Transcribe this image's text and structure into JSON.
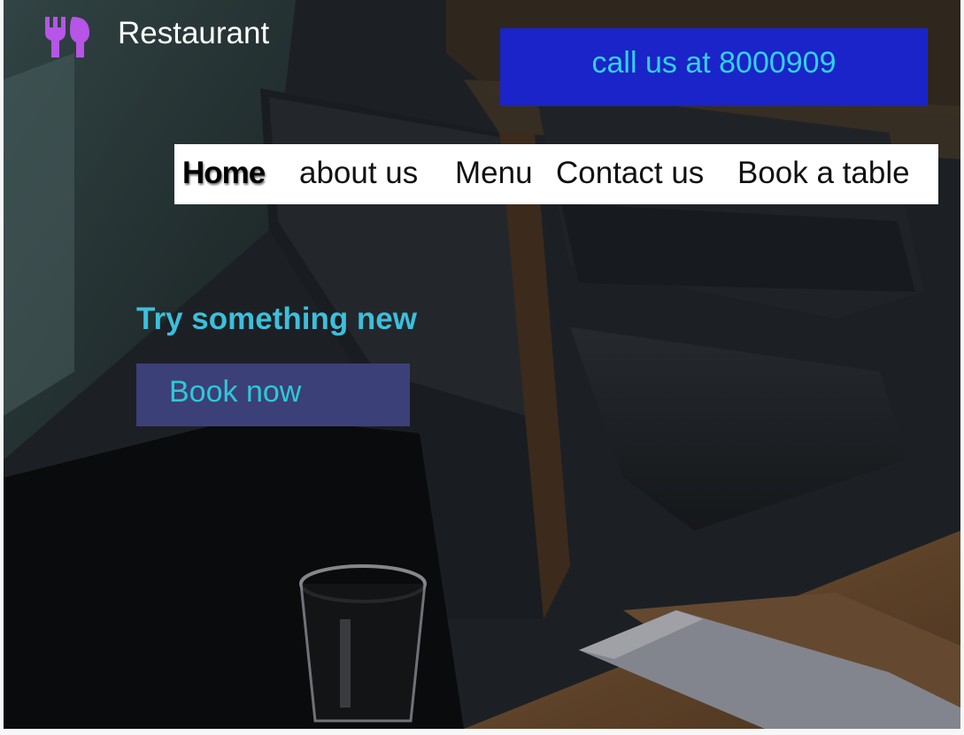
{
  "header": {
    "brand_name": "Restaurant",
    "logo_icon": "fork-spoon-icon",
    "logo_color": "#b655e6",
    "call_label": "call us at 8000909"
  },
  "nav": {
    "items": [
      {
        "label": "Home",
        "active": true
      },
      {
        "label": "about us",
        "active": false
      },
      {
        "label": "Menu",
        "active": false
      },
      {
        "label": "Contact us",
        "active": false
      },
      {
        "label": "Book a table",
        "active": false
      }
    ]
  },
  "hero": {
    "tagline": "Try something new",
    "cta_label": "Book now",
    "background": "dark restaurant interior photo"
  },
  "colors": {
    "call_button_bg": "#1a24c8",
    "call_button_text": "#33d0ea",
    "accent_text": "#3cbfdb",
    "cta_bg": "#3c4078",
    "nav_bg": "#ffffff"
  }
}
